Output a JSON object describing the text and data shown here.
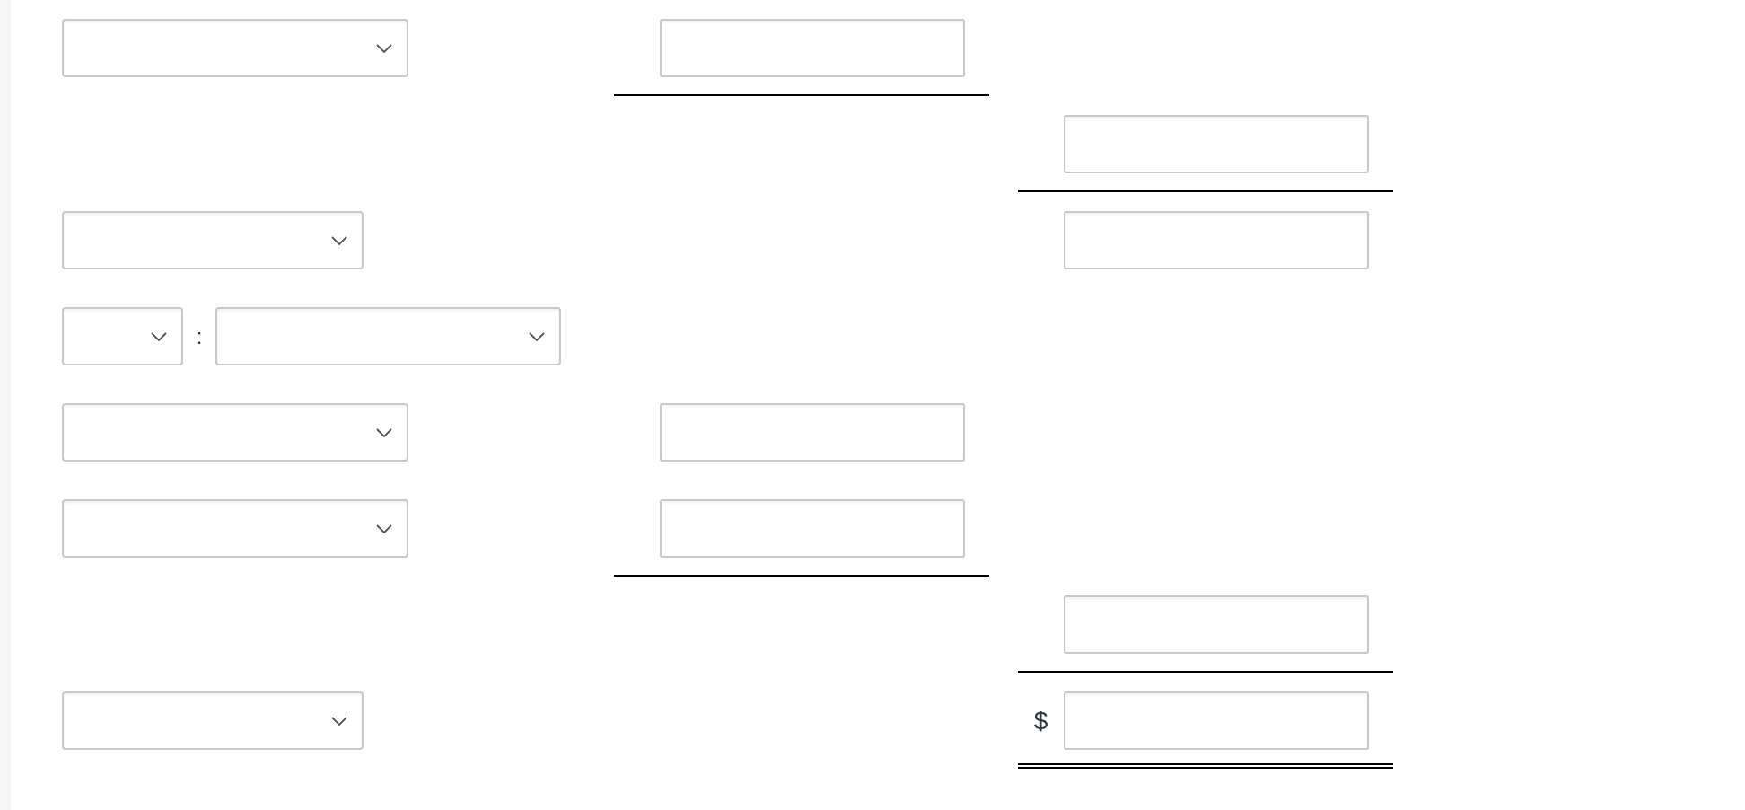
{
  "worksheet": {
    "rows": [
      {
        "label": {
          "kind": "dropdown"
        },
        "column_2": {
          "kind": "input",
          "underlined": true
        }
      },
      {
        "column_3": {
          "kind": "input",
          "underlined": true
        }
      },
      {
        "label": {
          "kind": "dropdown"
        },
        "column_3": {
          "kind": "input"
        }
      },
      {
        "label": {
          "kind": "dropdown_pair",
          "separator": ":"
        }
      },
      {
        "label": {
          "kind": "dropdown"
        },
        "column_2": {
          "kind": "input"
        }
      },
      {
        "label": {
          "kind": "dropdown"
        },
        "column_2": {
          "kind": "input",
          "underlined": true
        }
      },
      {
        "column_3": {
          "kind": "input",
          "underlined": true
        }
      },
      {
        "label": {
          "kind": "dropdown"
        },
        "column_3": {
          "kind": "input",
          "prefix": "$",
          "double_underlined": true
        }
      }
    ]
  }
}
